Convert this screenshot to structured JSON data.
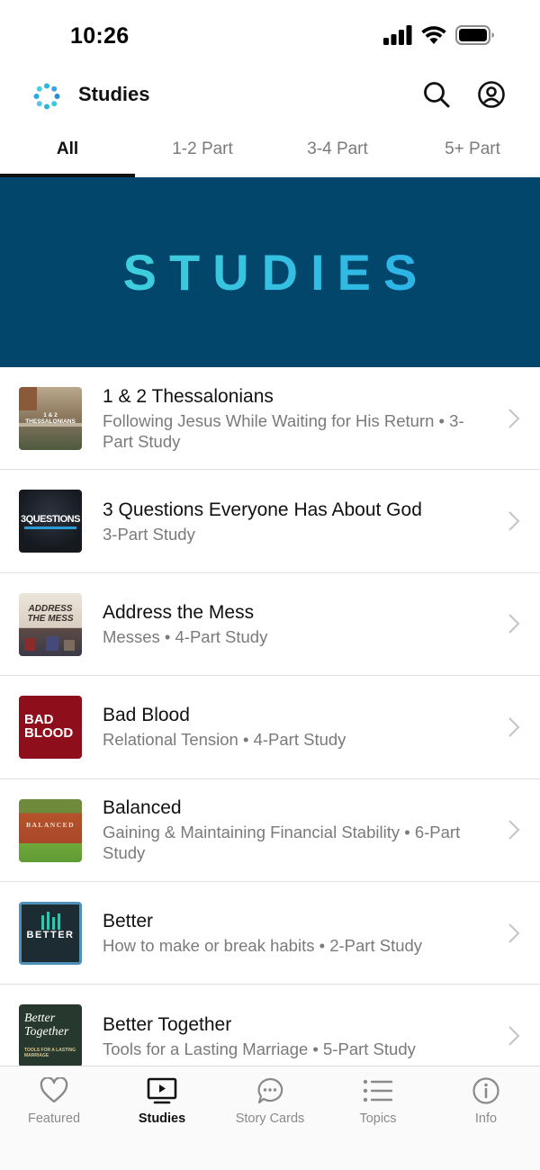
{
  "status_bar": {
    "time": "10:26",
    "icons": [
      "signal-icon",
      "wifi-icon",
      "battery-icon"
    ]
  },
  "header": {
    "title": "Studies",
    "logo": "app-logo-icon",
    "actions": [
      "search-icon",
      "profile-icon"
    ]
  },
  "tabs": [
    {
      "label": "All",
      "active": true
    },
    {
      "label": "1-2 Part",
      "active": false
    },
    {
      "label": "3-4 Part",
      "active": false
    },
    {
      "label": "5+ Part",
      "active": false
    }
  ],
  "banner": {
    "text": "STUDIES",
    "background": "#03466b",
    "text_color": "#3cc4df"
  },
  "studies": [
    {
      "title": "1 & 2 Thessalonians",
      "subtitle": "Following Jesus While Waiting for His Return • 3-Part Study",
      "thumb_text": "1 & 2 THESSALONIANS"
    },
    {
      "title": "3 Questions Everyone Has About God",
      "subtitle": "3-Part Study",
      "thumb_text": "3QUESTIONS"
    },
    {
      "title": "Address the Mess",
      "subtitle": "Messes • 4-Part Study",
      "thumb_text": "ADDRESS THE MESS"
    },
    {
      "title": "Bad Blood",
      "subtitle": "Relational Tension • 4-Part Study",
      "thumb_text": "BAD BLOOD"
    },
    {
      "title": "Balanced",
      "subtitle": "Gaining & Maintaining Financial Stability • 6-Part Study",
      "thumb_text": "BALANCED"
    },
    {
      "title": "Better",
      "subtitle": "How to make or break habits • 2-Part Study",
      "thumb_text": "BETTER"
    },
    {
      "title": "Better Together",
      "subtitle": "Tools for a Lasting Marriage • 5-Part Study",
      "thumb_text": "Better Together",
      "thumb_subtext": "TOOLS FOR A LASTING MARRIAGE"
    }
  ],
  "tab_bar": [
    {
      "label": "Featured",
      "icon": "heart-icon",
      "active": false
    },
    {
      "label": "Studies",
      "icon": "tv-icon",
      "active": true
    },
    {
      "label": "Story Cards",
      "icon": "chat-bubble-icon",
      "active": false
    },
    {
      "label": "Topics",
      "icon": "list-icon",
      "active": false
    },
    {
      "label": "Info",
      "icon": "info-icon",
      "active": false
    }
  ],
  "colors": {
    "active_text": "#111111",
    "inactive_text": "#7b7b7b",
    "divider": "#e2e2e2"
  }
}
